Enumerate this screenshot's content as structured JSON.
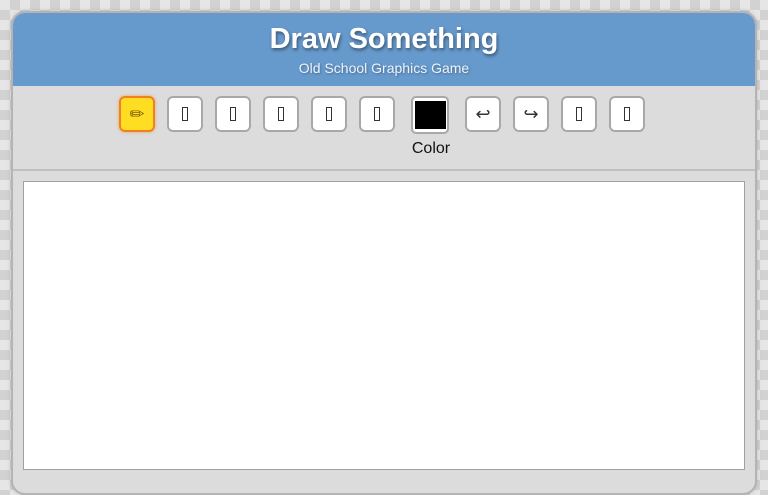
{
  "header": {
    "title": "Draw Something",
    "subtitle": "Old School Graphics Game"
  },
  "toolbar": {
    "tools": [
      {
        "icon": "pencil-icon",
        "glyph": "✏",
        "active": true
      },
      {
        "icon": "tool-icon",
        "glyph": ""
      },
      {
        "icon": "tool-icon",
        "glyph": ""
      },
      {
        "icon": "tool-icon",
        "glyph": ""
      },
      {
        "icon": "tool-icon",
        "glyph": ""
      },
      {
        "icon": "tool-icon",
        "glyph": ""
      }
    ],
    "color": {
      "label": "Color",
      "value": "#000000"
    },
    "undo_glyph": "↩",
    "redo_glyph": "↪"
  },
  "colors": {
    "header_bg": "#6699cc",
    "active_tool_bg": "#ffdd22",
    "active_tool_border": "#f08020"
  }
}
